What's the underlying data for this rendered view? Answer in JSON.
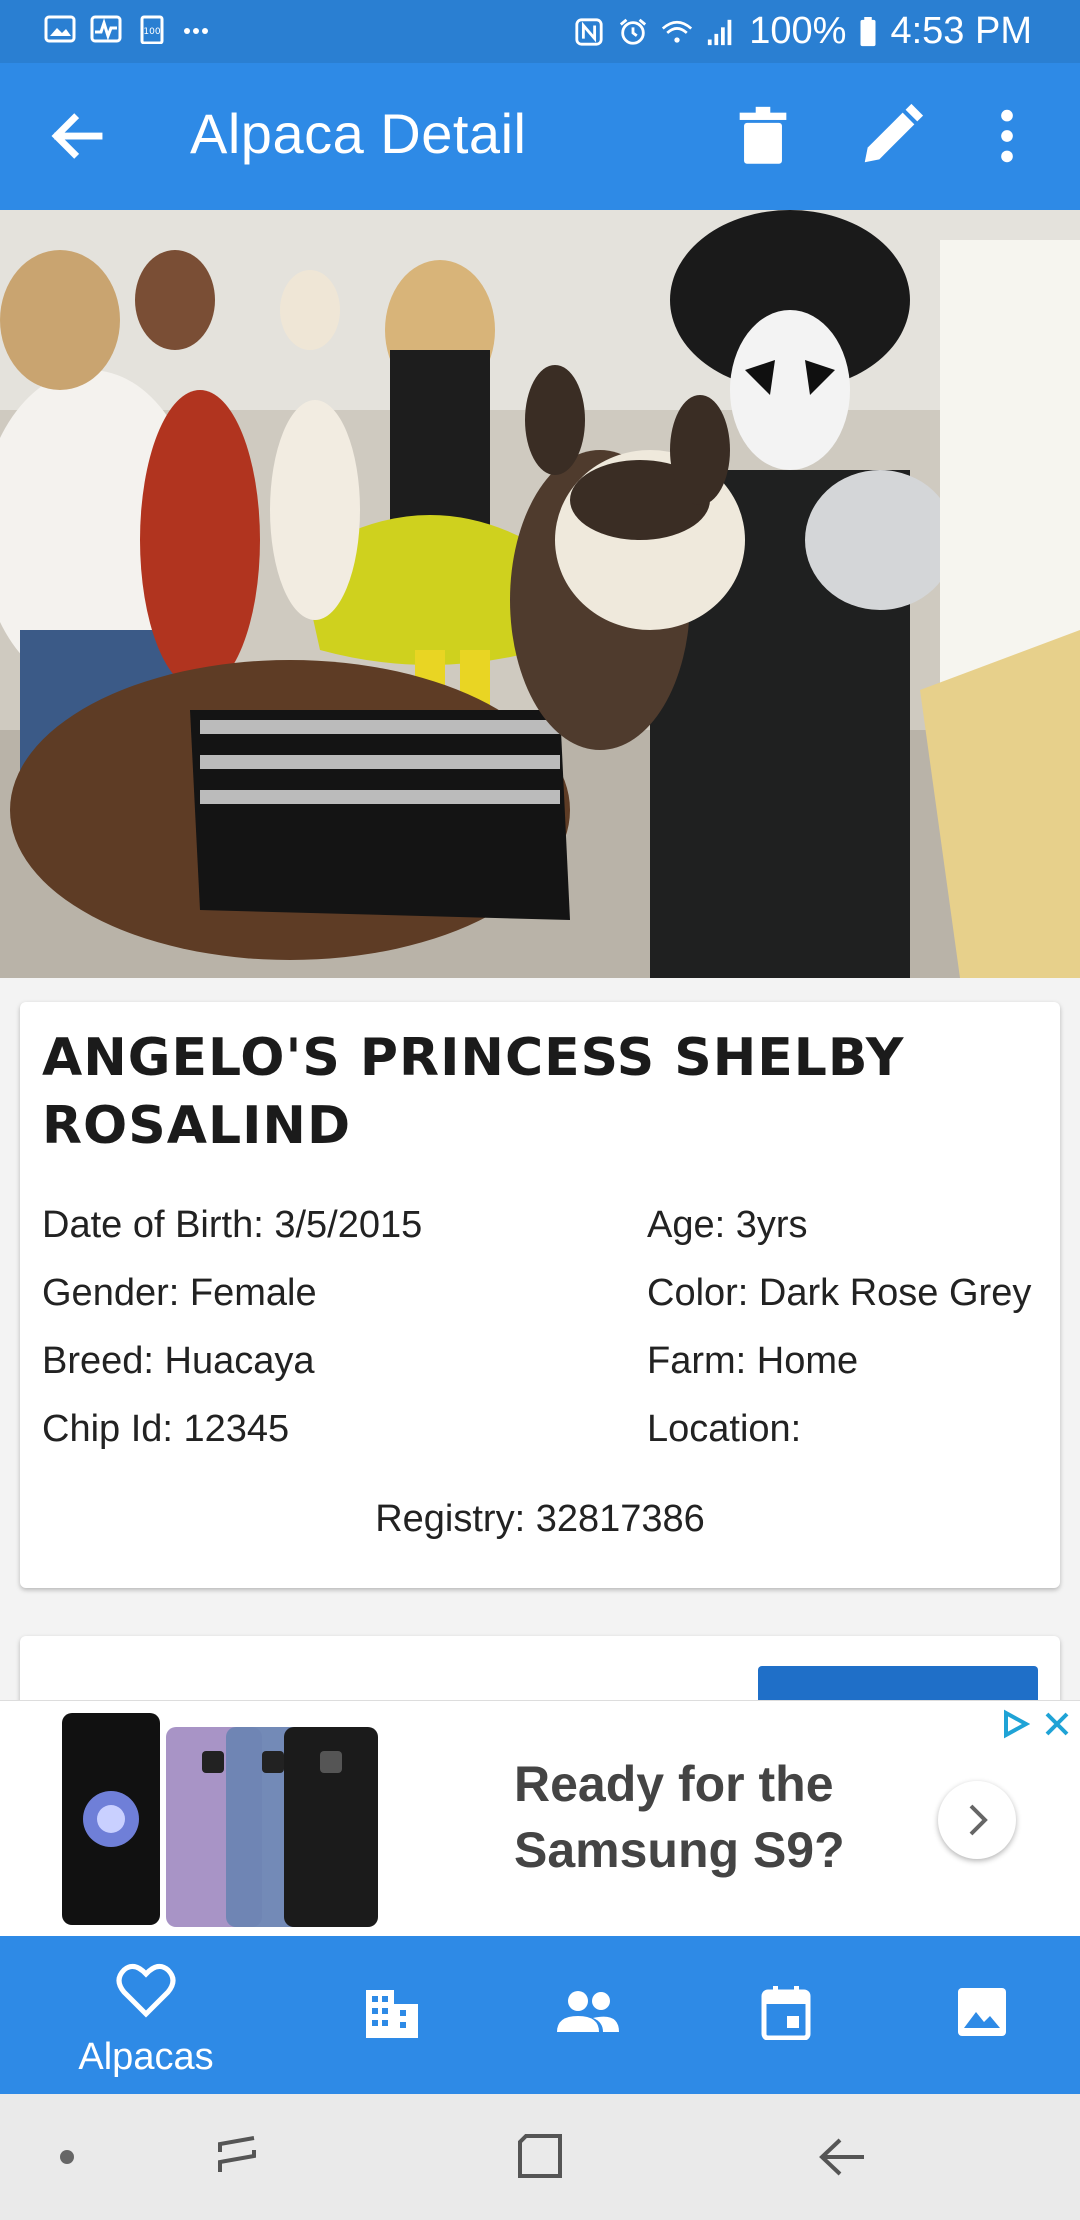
{
  "status_bar": {
    "battery": "100%",
    "time": "4:53 PM",
    "icons": [
      "gallery-icon",
      "activity-icon",
      "battery-saver-icon",
      "more-dots-icon",
      "nfc-icon",
      "alarm-icon",
      "wifi-icon",
      "signal-icon",
      "battery-icon"
    ]
  },
  "app_bar": {
    "title": "Alpaca Detail",
    "icons": [
      "back-arrow-icon",
      "trash-icon",
      "pencil-icon",
      "overflow-menu-icon"
    ]
  },
  "alpaca": {
    "name": "ANGELO'S PRINCESS SHELBY ROSALIND",
    "dob": "Date of Birth: 3/5/2015",
    "age": "Age: 3yrs",
    "gender": "Gender: Female",
    "color": "Color: Dark Rose Grey",
    "breed": "Breed: Huacaya",
    "farm": "Farm: Home",
    "chip": "Chip Id: 12345",
    "location": "Location:",
    "registry": "Registry: 32817386"
  },
  "ad": {
    "headline": "Ready for the Samsung S9?",
    "icons": [
      "ad-choices-icon",
      "close-icon",
      "chevron-right-icon"
    ]
  },
  "bottom_nav": {
    "items": [
      {
        "label": "Alpacas",
        "icon": "heart-icon",
        "active": true
      },
      {
        "label": "",
        "icon": "building-icon"
      },
      {
        "label": "",
        "icon": "people-icon"
      },
      {
        "label": "",
        "icon": "calendar-icon"
      },
      {
        "label": "",
        "icon": "image-icon"
      }
    ]
  },
  "colors": {
    "status_bar": "#2a7fd2",
    "app_bar": "#2e8ae6",
    "bottom_nav": "#2e8ae6",
    "accent_button": "#1f6fc8"
  }
}
